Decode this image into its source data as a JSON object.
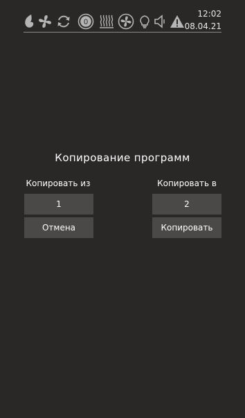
{
  "status_icons": [
    "drop-icon",
    "fan-icon",
    "cycle-icon",
    "zero-mode-icon",
    "heat-waves-icon",
    "circular-fan-icon",
    "lightbulb-icon",
    "speaker-icon",
    "warning-icon"
  ],
  "status": {
    "zero_label": "0",
    "time": "12:02",
    "date": "08.04.21"
  },
  "dialog": {
    "title": "Копирование программ",
    "from_label": "Копировать из",
    "to_label": "Копировать в",
    "from_value": "1",
    "to_value": "2",
    "cancel_label": "Отмена",
    "copy_label": "Копировать"
  },
  "colors": {
    "background": "#2a2827",
    "button": "#4a4947",
    "icon": "#b5b5b5"
  }
}
